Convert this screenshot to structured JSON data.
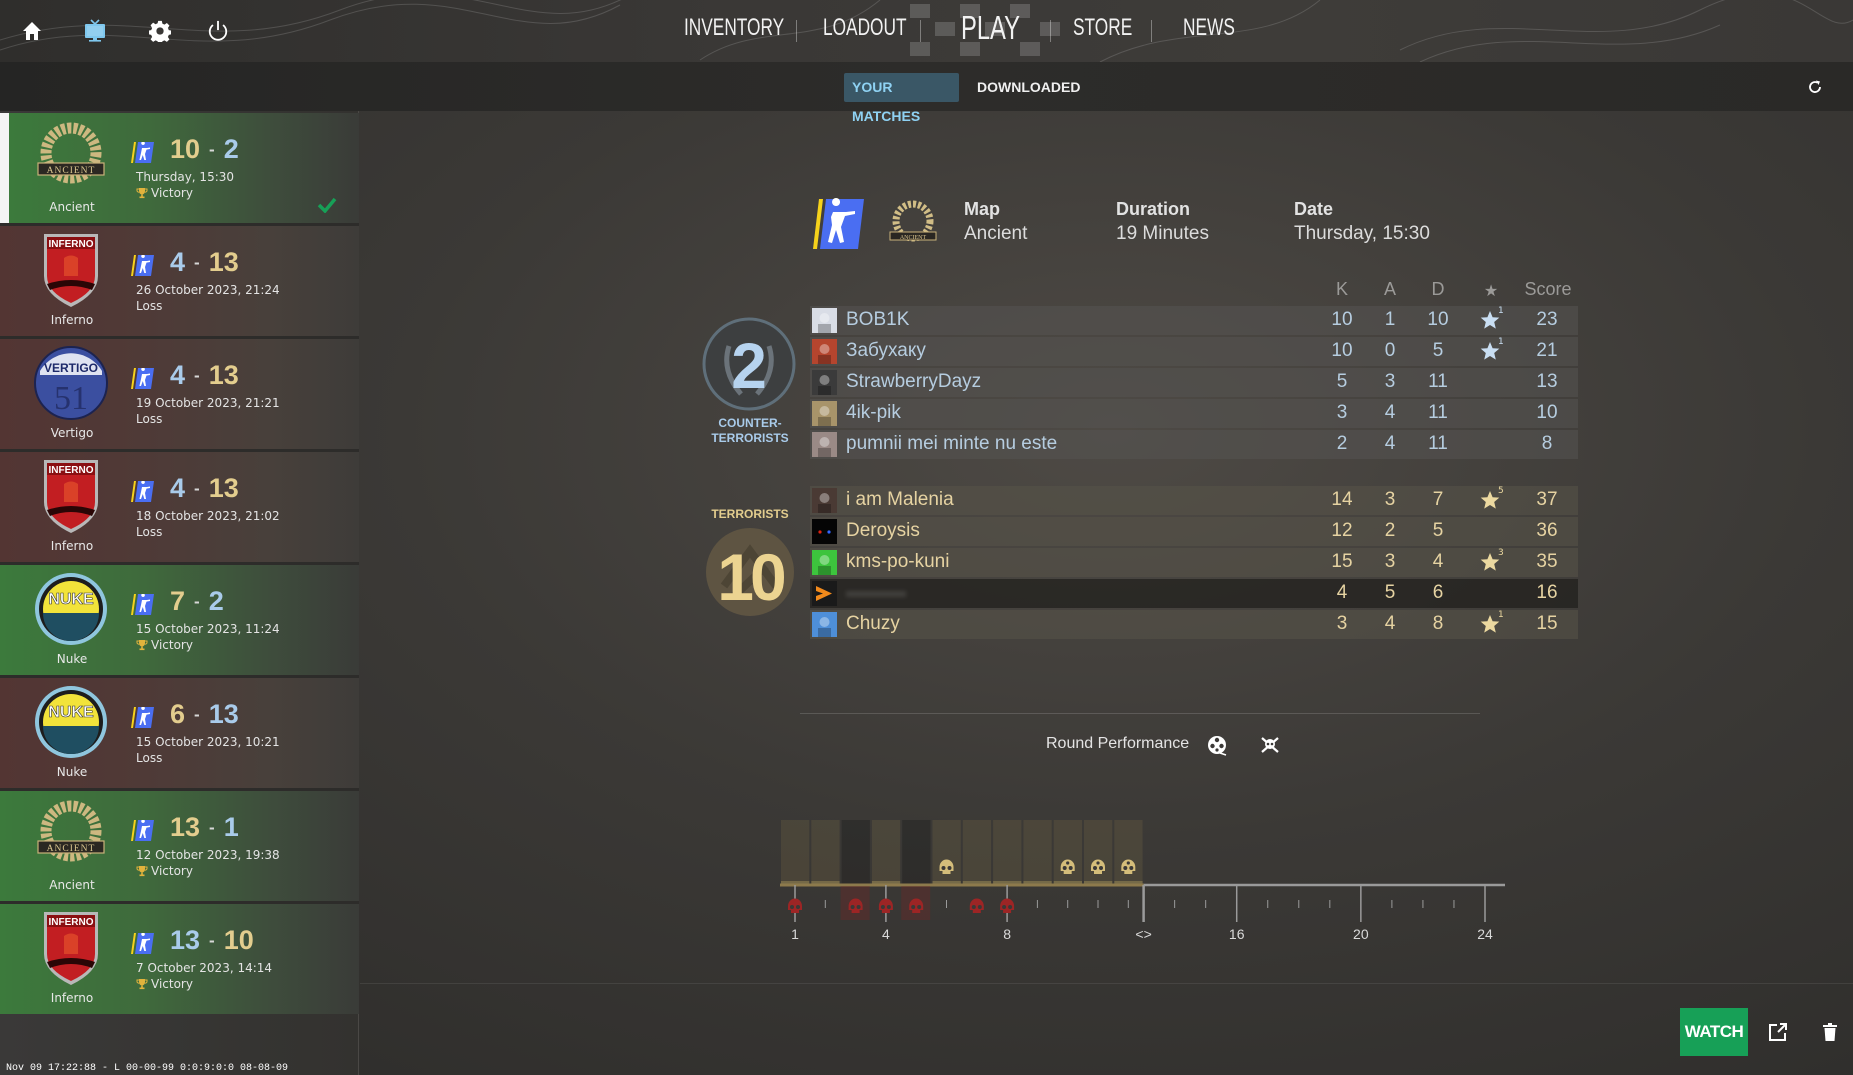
{
  "topbar": {
    "icons": [
      "home-icon",
      "watch-tv-icon",
      "settings-gear-icon",
      "power-icon"
    ],
    "nav": [
      {
        "label": "INVENTORY",
        "active": false
      },
      {
        "label": "LOADOUT",
        "active": false
      },
      {
        "label": "PLAY",
        "active": true
      },
      {
        "label": "STORE",
        "active": false
      },
      {
        "label": "NEWS",
        "active": false
      }
    ]
  },
  "subnav": {
    "tabs": [
      {
        "label": "YOUR MATCHES",
        "active": true
      },
      {
        "label": "DOWNLOADED",
        "active": false
      }
    ],
    "refresh_icon": "refresh-icon"
  },
  "colors": {
    "ct_blue": "#a9cbea",
    "t_gold": "#e3cd8e",
    "win_green": "#3c7a3c",
    "loss_red": "#533533",
    "watch_green": "#17a057",
    "check_green": "#17a057",
    "active_tab_bg": "#3a5766",
    "active_tab_text": "#8fd2f3"
  },
  "matches": [
    {
      "map": "Ancient",
      "score_left": "10",
      "score_right": "2",
      "left_team": "T",
      "right_team": "CT",
      "date": "Thursday, 15:30",
      "result": "Victory",
      "outcome": "win",
      "selected": true
    },
    {
      "map": "Inferno",
      "score_left": "4",
      "score_right": "13",
      "left_team": "CT",
      "right_team": "T",
      "date": "26 October 2023, 21:24",
      "result": "Loss",
      "outcome": "loss",
      "selected": false
    },
    {
      "map": "Vertigo",
      "score_left": "4",
      "score_right": "13",
      "left_team": "CT",
      "right_team": "T",
      "date": "19 October 2023, 21:21",
      "result": "Loss",
      "outcome": "loss",
      "selected": false
    },
    {
      "map": "Inferno",
      "score_left": "4",
      "score_right": "13",
      "left_team": "CT",
      "right_team": "T",
      "date": "18 October 2023, 21:02",
      "result": "Loss",
      "outcome": "loss",
      "selected": false
    },
    {
      "map": "Nuke",
      "score_left": "7",
      "score_right": "2",
      "left_team": "T",
      "right_team": "CT",
      "date": "15 October 2023, 11:24",
      "result": "Victory",
      "outcome": "win",
      "selected": false
    },
    {
      "map": "Nuke",
      "score_left": "6",
      "score_right": "13",
      "left_team": "T",
      "right_team": "CT",
      "date": "15 October 2023, 10:21",
      "result": "Loss",
      "outcome": "loss",
      "selected": false
    },
    {
      "map": "Ancient",
      "score_left": "13",
      "score_right": "1",
      "left_team": "T",
      "right_team": "CT",
      "date": "12 October 2023, 19:38",
      "result": "Victory",
      "outcome": "win",
      "selected": false
    },
    {
      "map": "Inferno",
      "score_left": "13",
      "score_right": "10",
      "left_team": "CT",
      "right_team": "T",
      "date": "7 October 2023, 14:14",
      "result": "Victory",
      "outcome": "win",
      "selected": false
    }
  ],
  "details": {
    "map_label": "Map",
    "map_value": "Ancient",
    "duration_label": "Duration",
    "duration_value": "19 Minutes",
    "date_label": "Date",
    "date_value": "Thursday, 15:30"
  },
  "scoreboard": {
    "columns": {
      "k": "K",
      "a": "A",
      "d": "D",
      "mvp": "★",
      "score": "Score"
    },
    "ct": {
      "label_line1": "COUNTER-",
      "label_line2": "TERRORISTS",
      "score": "2",
      "players": [
        {
          "name": "BOB1K",
          "k": "10",
          "a": "1",
          "d": "10",
          "mvp": "1",
          "score": "23"
        },
        {
          "name": "Забухаку",
          "k": "10",
          "a": "0",
          "d": "5",
          "mvp": "1",
          "score": "21"
        },
        {
          "name": "StrawberryDayz",
          "k": "5",
          "a": "3",
          "d": "11",
          "mvp": "",
          "score": "13"
        },
        {
          "name": "4ik-pik",
          "k": "3",
          "a": "4",
          "d": "11",
          "mvp": "",
          "score": "10"
        },
        {
          "name": "pumnii mei minte nu este",
          "k": "2",
          "a": "4",
          "d": "11",
          "mvp": "",
          "score": "8"
        }
      ]
    },
    "t": {
      "label": "TERRORISTS",
      "score": "10",
      "players": [
        {
          "name": "i am Malenia",
          "k": "14",
          "a": "3",
          "d": "7",
          "mvp": "5",
          "score": "37"
        },
        {
          "name": "Deroysis",
          "k": "12",
          "a": "2",
          "d": "5",
          "mvp": "",
          "score": "36"
        },
        {
          "name": "kms-po-kuni",
          "k": "15",
          "a": "3",
          "d": "4",
          "mvp": "3",
          "score": "35"
        },
        {
          "name": "",
          "k": "4",
          "a": "5",
          "d": "6",
          "mvp": "",
          "score": "16",
          "is_you": true
        },
        {
          "name": "Chuzy",
          "k": "3",
          "a": "4",
          "d": "8",
          "mvp": "1",
          "score": "15"
        }
      ]
    }
  },
  "round_performance": {
    "title": "Round Performance",
    "buttons": [
      "film-reel-icon",
      "skull-crossbones-icon"
    ],
    "axis_labels": [
      "1",
      "4",
      "8",
      "<>",
      "16",
      "20",
      "24"
    ],
    "rounds_played": 12,
    "kill_rounds": [
      6,
      10,
      11,
      12
    ],
    "death_rounds": [
      1,
      3,
      4,
      5,
      7,
      8
    ]
  },
  "chart_data": {
    "type": "bar",
    "title": "Round Performance",
    "categories": [
      "1",
      "2",
      "3",
      "4",
      "5",
      "6",
      "7",
      "8",
      "9",
      "10",
      "11",
      "12"
    ],
    "series": [
      {
        "name": "kills (skull above axis)",
        "values": [
          0,
          0,
          0,
          0,
          0,
          1,
          0,
          0,
          0,
          1,
          1,
          1
        ]
      },
      {
        "name": "deaths (red skull below axis)",
        "values": [
          1,
          0,
          1,
          1,
          1,
          0,
          1,
          1,
          0,
          0,
          0,
          0
        ]
      }
    ],
    "round_winner": [
      "T",
      "T",
      "CT",
      "T",
      "CT",
      "T",
      "T",
      "T",
      "T",
      "T",
      "T",
      "T"
    ],
    "xlabel": "",
    "ylabel": "",
    "x_tick_labels": [
      "1",
      "4",
      "8",
      "<>",
      "16",
      "20",
      "24"
    ],
    "xlim": [
      1,
      24
    ]
  },
  "actions": {
    "watch_label": "WATCH",
    "open_external_icon": "external-link-icon",
    "delete_icon": "trash-icon"
  },
  "debug_text": "Nov 09 17:22:88 - L 00-00-99 0:0:9:0:0 08-08-09"
}
